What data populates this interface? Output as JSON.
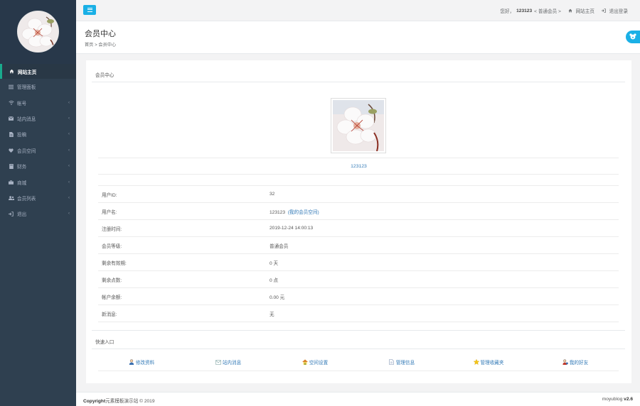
{
  "topbar": {
    "greeting": "您好，",
    "username": "123123",
    "level_text": "< 普通会员 >",
    "home_link": "网站主页",
    "logout_link": "退出登录"
  },
  "sidebar": {
    "items": [
      {
        "label": "网站主页",
        "icon": "home-icon",
        "active": true
      },
      {
        "label": "管理面板",
        "icon": "list-icon"
      },
      {
        "label": "帐号",
        "icon": "wifi-icon"
      },
      {
        "label": "站内消息",
        "icon": "envelope-icon"
      },
      {
        "label": "投稿",
        "icon": "file-icon"
      },
      {
        "label": "会员空间",
        "icon": "heart-icon"
      },
      {
        "label": "财务",
        "icon": "book-icon"
      },
      {
        "label": "商城",
        "icon": "briefcase-icon"
      },
      {
        "label": "会员列表",
        "icon": "users-icon"
      },
      {
        "label": "退出",
        "icon": "signout-icon"
      }
    ],
    "arrow": "‹"
  },
  "page": {
    "title": "会员中心",
    "breadcrumb": "首页 > 会员中心"
  },
  "panel": {
    "heading": "会员中心",
    "display_name": "123123",
    "rows": [
      {
        "label": "用户ID:",
        "value": "32"
      },
      {
        "label": "用户名:",
        "value": "123123",
        "link": "(我的会员空间)"
      },
      {
        "label": "注册时间:",
        "value": "2019-12-24 14:00:13"
      },
      {
        "label": "会员等级:",
        "value": "普通会员"
      },
      {
        "label": "剩余有效期:",
        "value": "0 天"
      },
      {
        "label": "剩余点数:",
        "value": "0 点"
      },
      {
        "label": "帐户余额:",
        "value": "0.00 元"
      },
      {
        "label": "新消息:",
        "value": "无"
      }
    ],
    "quick_heading": "快速入口",
    "quick_links": [
      {
        "label": "修改资料",
        "icon": "user-edit-icon"
      },
      {
        "label": "站内消息",
        "icon": "mail-icon"
      },
      {
        "label": "空间设置",
        "icon": "house-icon"
      },
      {
        "label": "管理信息",
        "icon": "document-icon"
      },
      {
        "label": "管理收藏夹",
        "icon": "star-icon"
      },
      {
        "label": "我的好友",
        "icon": "friends-icon"
      }
    ]
  },
  "footer": {
    "copyright_bold": "Copyright",
    "copyright_rest": "元素模板演示站 © 2019",
    "brand": "moyublog",
    "version": "v2.6"
  },
  "colors": {
    "sidebar_bg": "#2f4050",
    "accent_blue": "#1ab0e6",
    "link": "#337ab7",
    "active_border": "#19aa8d"
  }
}
